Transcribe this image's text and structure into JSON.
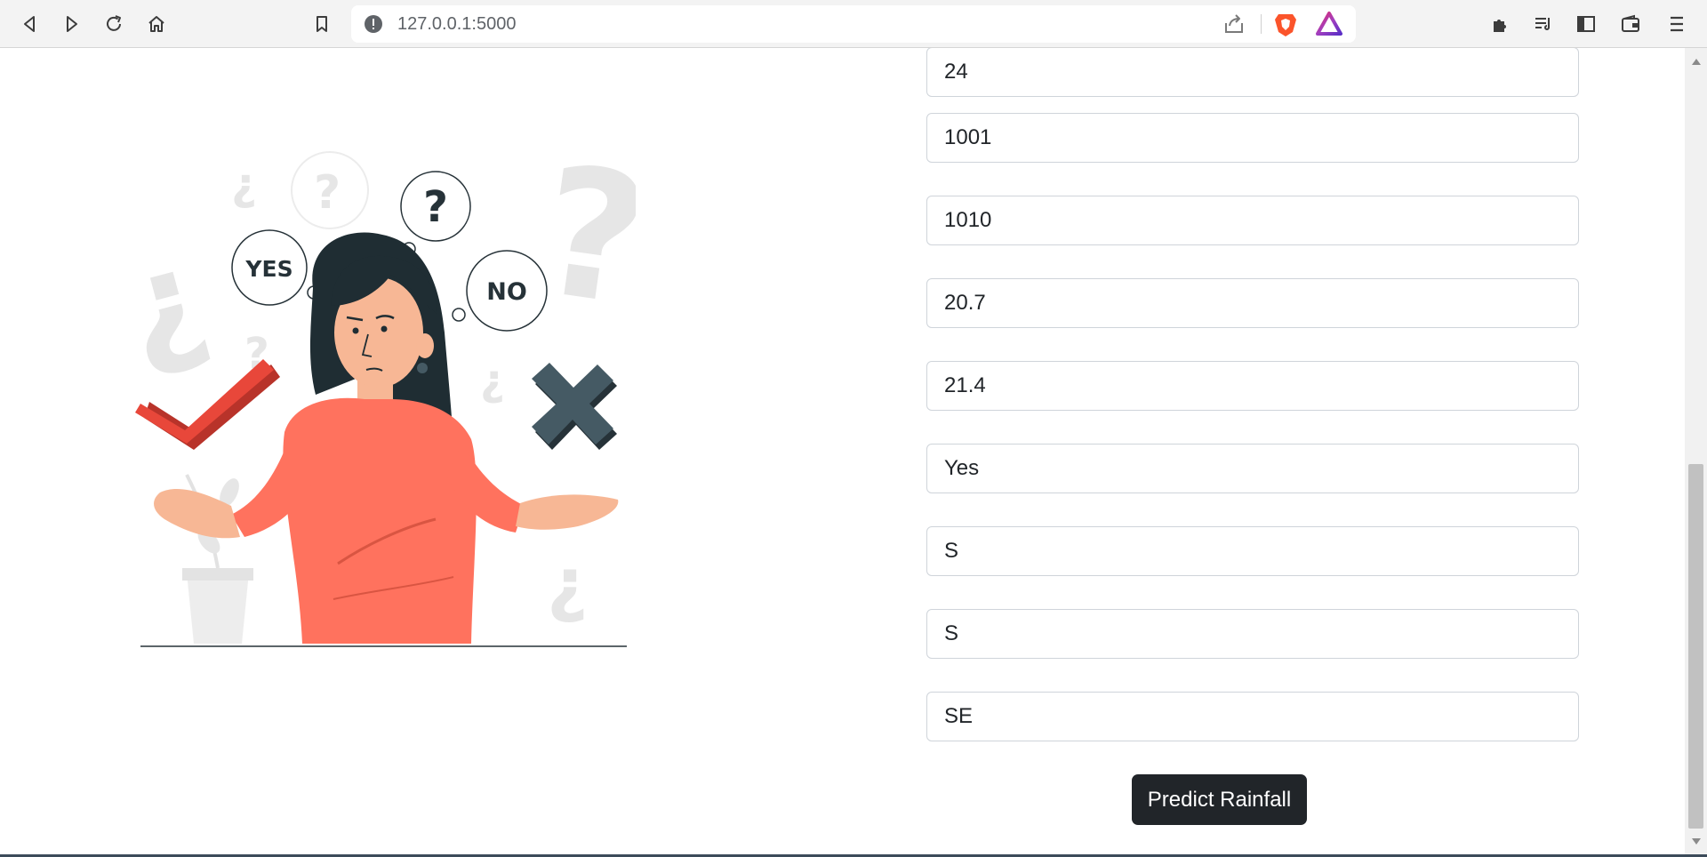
{
  "browser": {
    "url": "127.0.0.1:5000",
    "icons": {
      "back": "back-icon",
      "forward": "forward-icon",
      "reload": "reload-icon",
      "home": "home-icon",
      "bookmark": "bookmark-icon",
      "info": "info-icon",
      "share": "share-icon",
      "brave_shields": "brave-shields-icon",
      "brave_rewards": "brave-rewards-icon",
      "extensions": "extensions-icon",
      "playlist": "playlist-icon",
      "sidebar": "sidebar-icon",
      "wallet": "wallet-icon",
      "menu": "menu-icon"
    }
  },
  "illustration": {
    "bubble_yes": "YES",
    "bubble_no": "NO",
    "bubble_question": "?"
  },
  "form": {
    "fields": [
      {
        "name": "field-1",
        "value": "24"
      },
      {
        "name": "field-2",
        "value": "1001"
      },
      {
        "name": "field-3",
        "value": "1010"
      },
      {
        "name": "field-4",
        "value": "20.7"
      },
      {
        "name": "field-5",
        "value": "21.4"
      },
      {
        "name": "field-6",
        "value": "Yes"
      },
      {
        "name": "field-7",
        "value": "S"
      },
      {
        "name": "field-8",
        "value": "S"
      },
      {
        "name": "field-9",
        "value": "SE"
      }
    ],
    "submit_label": "Predict Rainfall"
  },
  "colors": {
    "accent": "#212529",
    "shirt": "#ff725e",
    "hair": "#1f2d33",
    "check": "#e8473a",
    "cross": "#37474f"
  }
}
